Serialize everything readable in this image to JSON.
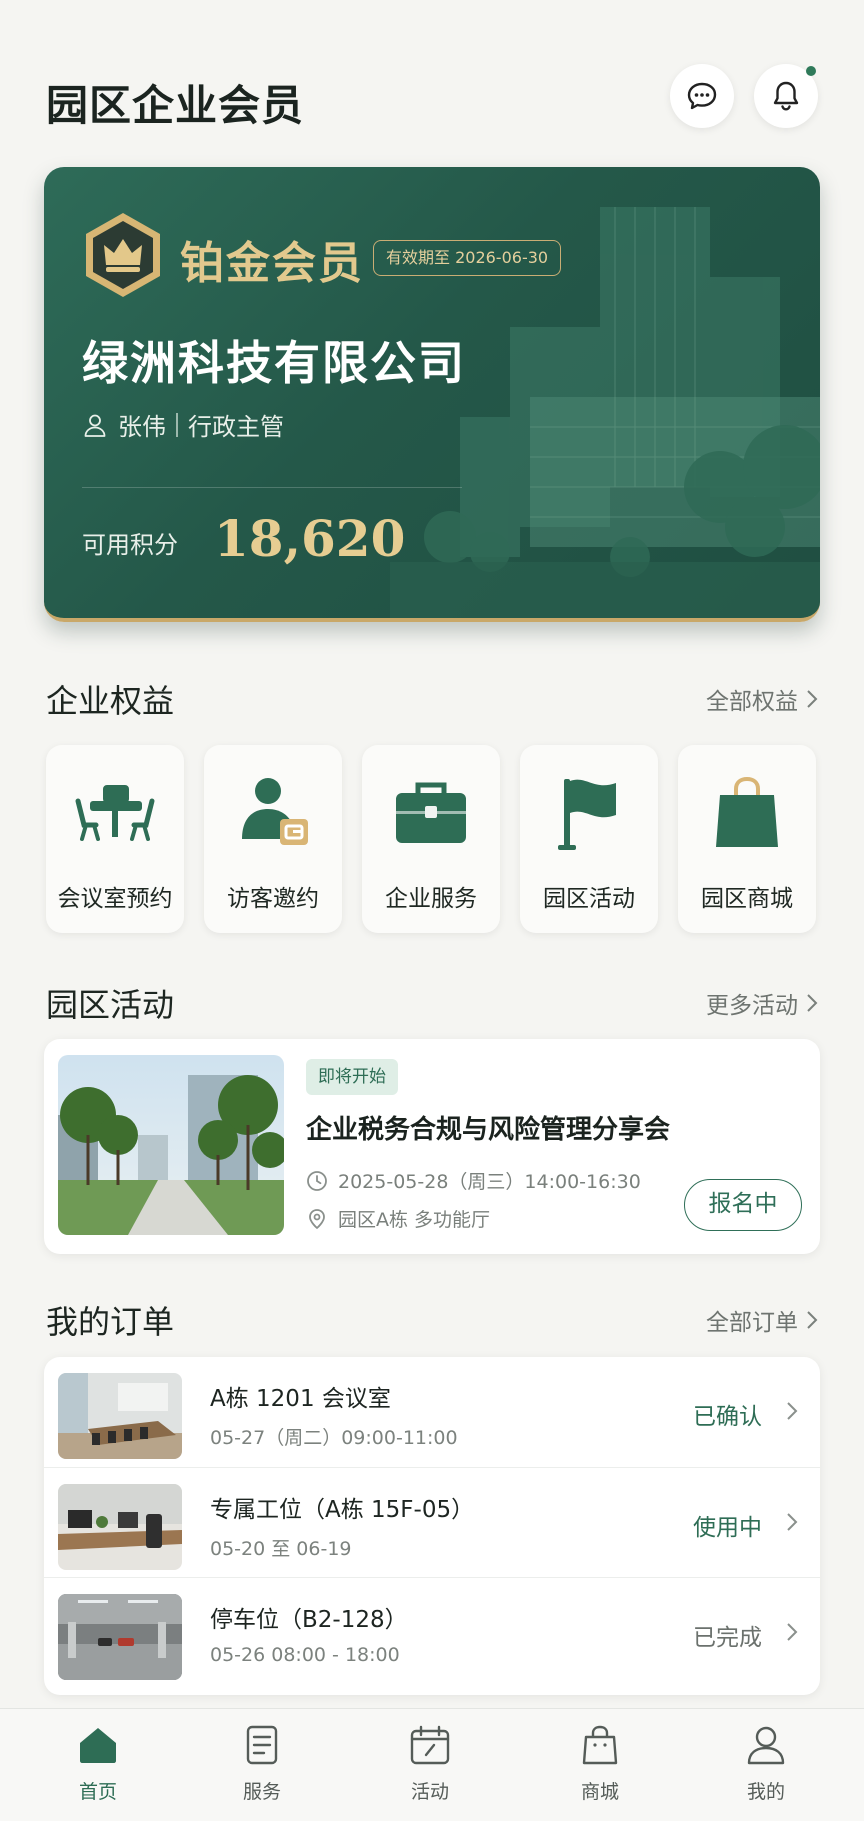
{
  "header": {
    "title": "园区企业会员"
  },
  "member_card": {
    "level": "铂金会员",
    "validity": "有效期至 2026-06-30",
    "company": "绿洲科技有限公司",
    "user_name": "张伟",
    "user_role": "行政主管",
    "points_label": "可用积分",
    "points_value": "18,620"
  },
  "benefits": {
    "title": "企业权益",
    "more": "全部权益",
    "items": [
      {
        "label": "会议室预约",
        "icon": "meeting-room-icon"
      },
      {
        "label": "访客邀约",
        "icon": "visitor-icon"
      },
      {
        "label": "企业服务",
        "icon": "briefcase-icon"
      },
      {
        "label": "园区活动",
        "icon": "flag-icon"
      },
      {
        "label": "园区商城",
        "icon": "shopping-bag-icon"
      }
    ]
  },
  "activities": {
    "title": "园区活动",
    "more": "更多活动",
    "event": {
      "tag": "即将开始",
      "title": "企业税务合规与风险管理分享会",
      "time": "2025-05-28（周三）14:00-16:30",
      "location": "园区A栋 多功能厅",
      "button": "报名中"
    }
  },
  "orders": {
    "title": "我的订单",
    "more": "全部订单",
    "items": [
      {
        "title": "A栋 1201 会议室",
        "sub": "05-27（周二）09:00-11:00",
        "status": "已确认"
      },
      {
        "title": "专属工位（A栋 15F-05）",
        "sub": "05-20 至 06-19",
        "status": "使用中"
      },
      {
        "title": "停车位（B2-128）",
        "sub": "05-26 08:00 - 18:00",
        "status": "已完成"
      }
    ]
  },
  "tabbar": {
    "items": [
      {
        "label": "首页",
        "icon": "home-icon",
        "active": true
      },
      {
        "label": "服务",
        "icon": "document-icon"
      },
      {
        "label": "活动",
        "icon": "calendar-icon"
      },
      {
        "label": "商城",
        "icon": "shopping-bag-icon"
      },
      {
        "label": "我的",
        "icon": "person-icon"
      }
    ]
  },
  "colors": {
    "brand": "#2e6d55",
    "gold": "#e2c98e",
    "card": "#245849"
  }
}
